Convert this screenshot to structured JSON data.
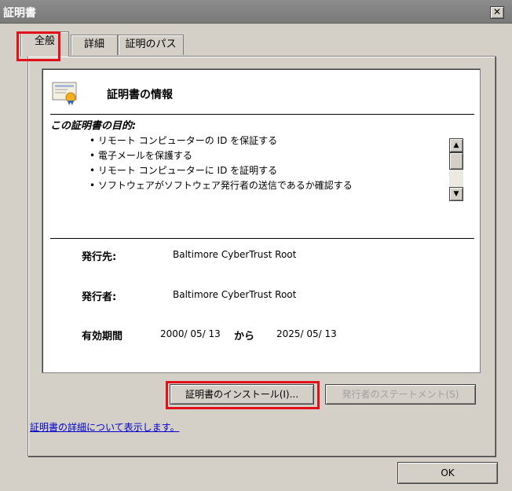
{
  "window": {
    "title": "証明書",
    "close_glyph": "✕"
  },
  "tabs": [
    {
      "label": "全般",
      "active": true
    },
    {
      "label": "詳細",
      "active": false
    },
    {
      "label": "証明のパス",
      "active": false
    }
  ],
  "info": {
    "title": "証明書の情報",
    "icon": "certificate-icon",
    "purpose_title": "この証明書の目的:",
    "purposes": [
      "リモート コンピューターの ID を保証する",
      "電子メールを保護する",
      "リモート コンピューターに ID を証明する",
      "ソフトウェアがソフトウェア発行者の送信であるか確認する"
    ],
    "issued_to_label": "発行先:",
    "issued_to": "Baltimore CyberTrust Root",
    "issued_by_label": "発行者:",
    "issued_by": "Baltimore CyberTrust Root",
    "validity_label": "有効期間",
    "valid_from": "2000/ 05/ 13",
    "valid_to_word": "から",
    "valid_to": "2025/ 05/ 13"
  },
  "buttons": {
    "install": "証明書のインストール(I)...",
    "statement": "発行者のステートメント(S)",
    "ok": "OK"
  },
  "link": {
    "more_info": "証明書の詳細について表示します。"
  },
  "highlight_color": "#e2101a"
}
